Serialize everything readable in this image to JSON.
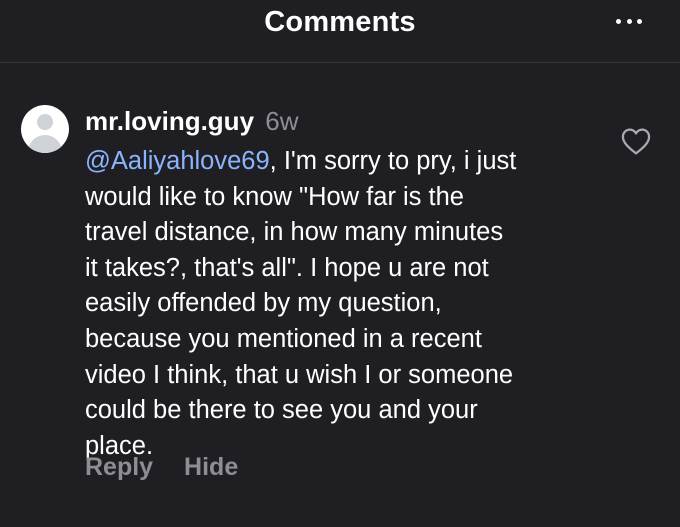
{
  "header": {
    "title": "Comments",
    "more_icon": "more-horizontal-icon"
  },
  "comment": {
    "username": "mr.loving.guy",
    "time": "6w",
    "mention": "@Aaliyahlove69",
    "lines": [
      ", I'm sorry to pry, i just",
      "would like to know \"How far is the",
      "travel distance, in how many minutes",
      "it takes?, that's all\". I hope u are not",
      "easily offended by my question,",
      "because you mentioned in a recent",
      "video I think, that u wish I or someone",
      "could be there to see you and your",
      "place."
    ],
    "reply_label": "Reply",
    "hide_label": "Hide",
    "like_icon": "heart-outline-icon",
    "avatar_icon": "default-avatar-icon"
  },
  "colors": {
    "background": "#1f1e22",
    "mention": "#8ab4ff",
    "muted": "#8e8d93"
  }
}
